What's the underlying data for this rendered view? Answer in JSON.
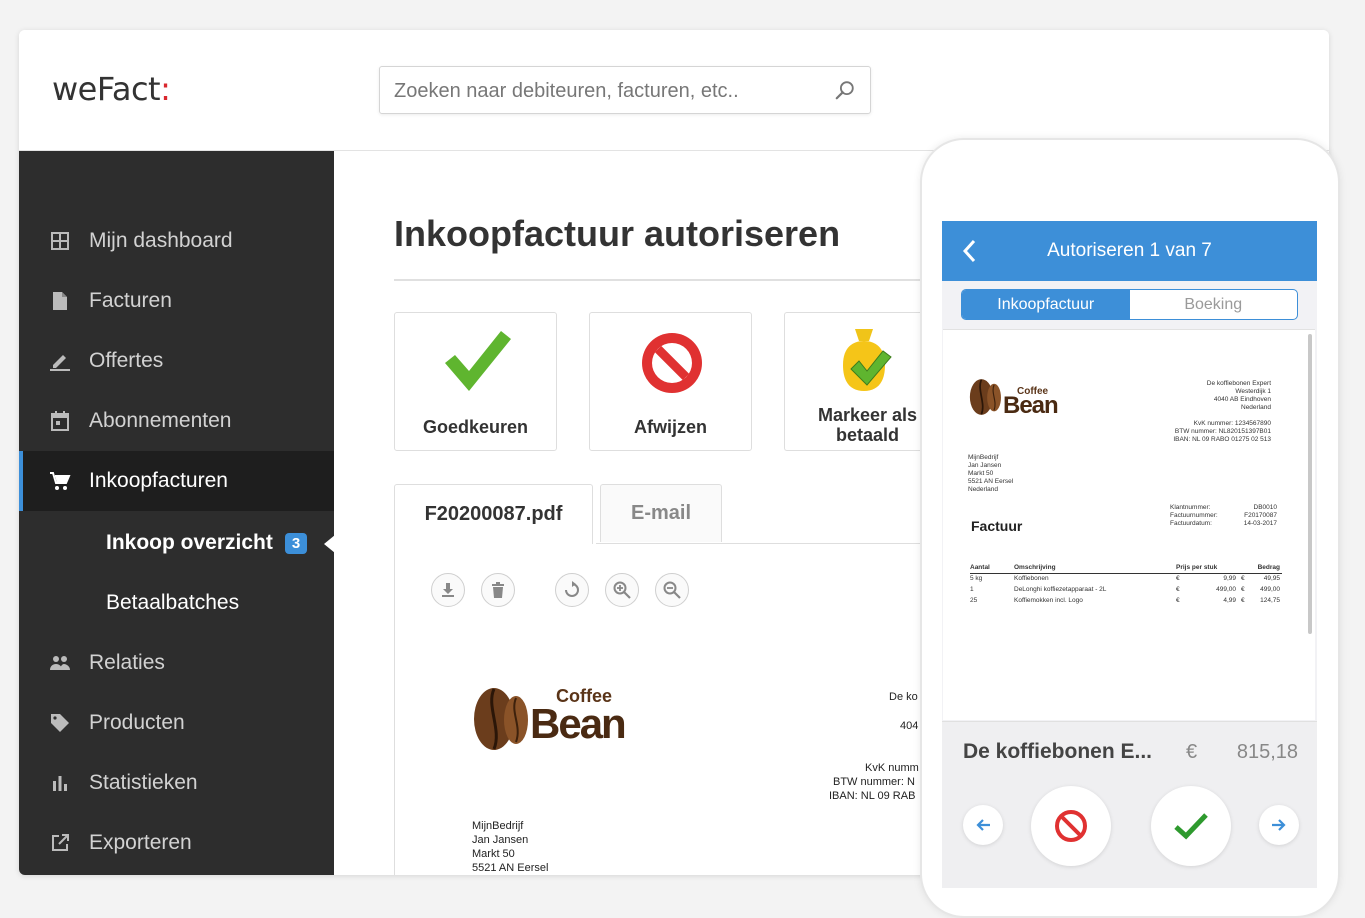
{
  "app": {
    "logo_text": "weFact",
    "logo_colon": ":"
  },
  "search": {
    "placeholder": "Zoeken naar debiteuren, facturen, etc.."
  },
  "sidebar": {
    "items": [
      {
        "label": "Mijn dashboard",
        "icon": "grid-icon"
      },
      {
        "label": "Facturen",
        "icon": "document-icon"
      },
      {
        "label": "Offertes",
        "icon": "pencil-icon"
      },
      {
        "label": "Abonnementen",
        "icon": "calendar-icon"
      },
      {
        "label": "Inkoopfacturen",
        "icon": "cart-icon"
      },
      {
        "label": "Relaties",
        "icon": "people-icon"
      },
      {
        "label": "Producten",
        "icon": "tag-icon"
      },
      {
        "label": "Statistieken",
        "icon": "bar-chart-icon"
      },
      {
        "label": "Exporteren",
        "icon": "export-icon"
      }
    ],
    "sub_items": [
      {
        "label": "Inkoop overzicht",
        "badge": "3"
      },
      {
        "label": "Betaalbatches"
      }
    ]
  },
  "main": {
    "title": "Inkoopfactuur autoriseren",
    "actions": {
      "approve": "Goedkeuren",
      "reject": "Afwijzen",
      "mark_paid_line1": "Markeer als",
      "mark_paid_line2": "betaald"
    },
    "tabs": {
      "pdf": "F20200087.pdf",
      "email": "E-mail"
    },
    "document": {
      "logo_small": "Coffee",
      "logo_big": "Bean",
      "sender_fragments": [
        "De ko",
        "404",
        "KvK numm",
        "BTW nummer: N",
        "IBAN: NL 09 RAB"
      ],
      "recipient": [
        "MijnBedrijf",
        "Jan Jansen",
        "Markt 50",
        "5521 AN  Eersel"
      ]
    }
  },
  "mobile": {
    "header": "Autoriseren 1 van 7",
    "segments": {
      "active": "Inkoopfactuur",
      "inactive": "Boeking"
    },
    "invoice": {
      "logo_small": "Coffee",
      "logo_big": "Bean",
      "sender": [
        "De koffiebonen Expert",
        "Westerdijk 1",
        "4040 AB Eindhoven",
        "Nederland"
      ],
      "ids": [
        "KvK nummer: 1234567890",
        "BTW nummer: NL820151397B01",
        "IBAN: NL 09 RABO 01275 02 513"
      ],
      "recipient": [
        "MijnBedrijf",
        "Jan Jansen",
        "Markt 50",
        "5521 AN  Eersel",
        "Nederland"
      ],
      "meta_labels": [
        "Klantnummer:",
        "Factuurnummer:",
        "Factuurdatum:"
      ],
      "meta_values": [
        "DB0010",
        "F20170087",
        "14-03-2017"
      ],
      "heading": "Factuur",
      "columns": [
        "Aantal",
        "Omschrijving",
        "Prijs per stuk",
        "Bedrag"
      ],
      "rows": [
        {
          "qty": "5 kg",
          "desc": "Koffiebonen",
          "cur1": "€",
          "price": "9,99",
          "cur2": "€",
          "amount": "49,95"
        },
        {
          "qty": "1",
          "desc": "DeLonghi koffiezetapparaat - 2L",
          "cur1": "€",
          "price": "499,00",
          "cur2": "€",
          "amount": "499,00"
        },
        {
          "qty": "25",
          "desc": "Koffiemokken incl. Logo",
          "cur1": "€",
          "price": "4,99",
          "cur2": "€",
          "amount": "124,75"
        }
      ]
    },
    "vendor": "De koffiebonen E...",
    "currency": "€",
    "amount": "815,18"
  },
  "colors": {
    "accent": "#3c8fd9",
    "sidebar": "#2d2d2d",
    "approve": "#5fb52f",
    "reject": "#e03131",
    "logo_brown": "#5a3418"
  }
}
